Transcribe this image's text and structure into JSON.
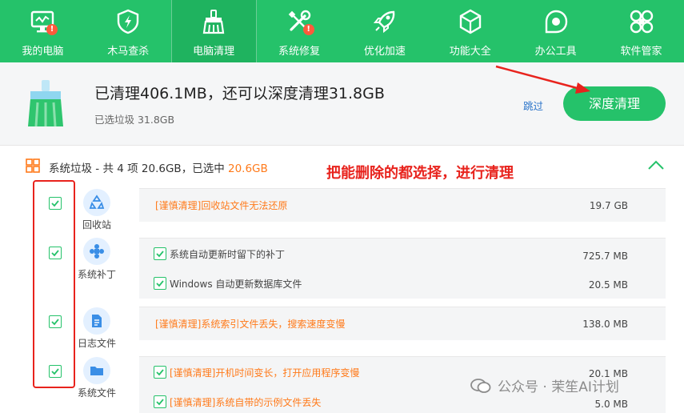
{
  "nav": {
    "items": [
      {
        "label": "我的电脑",
        "icon": "monitor-icon",
        "badge": "!"
      },
      {
        "label": "木马查杀",
        "icon": "shield-bolt-icon",
        "badge": ""
      },
      {
        "label": "电脑清理",
        "icon": "broom-icon",
        "badge": ""
      },
      {
        "label": "系统修复",
        "icon": "tools-icon",
        "badge": "!"
      },
      {
        "label": "优化加速",
        "icon": "rocket-icon",
        "badge": ""
      },
      {
        "label": "功能大全",
        "icon": "cube-icon",
        "badge": ""
      },
      {
        "label": "办公工具",
        "icon": "office-icon",
        "badge": ""
      },
      {
        "label": "软件管家",
        "icon": "apps-icon",
        "badge": ""
      }
    ],
    "active_index": 2
  },
  "summary": {
    "title": "已清理406.1MB，还可以深度清理31.8GB",
    "subtitle": "已选垃圾 31.8GB",
    "skip_label": "跳过",
    "deep_clean_label": "深度清理"
  },
  "section": {
    "title_prefix": "系统垃圾 - 共 4 项 20.6GB，已选中 ",
    "title_selected": "20.6GB",
    "annotation": "把能删除的都选择，进行清理"
  },
  "groups": [
    {
      "label": "回收站",
      "icon": "recycle-icon",
      "items": [
        {
          "text": "[谨慎清理]回收站文件无法还原",
          "size": "19.7 GB",
          "warn": true,
          "checkbox": false
        }
      ]
    },
    {
      "label": "系统补丁",
      "icon": "patch-icon",
      "items": [
        {
          "text": "系统自动更新时留下的补丁",
          "size": "725.7 MB",
          "warn": false,
          "checkbox": true
        },
        {
          "text": "Windows 自动更新数据库文件",
          "size": "20.5 MB",
          "warn": false,
          "checkbox": true
        }
      ]
    },
    {
      "label": "日志文件",
      "icon": "log-file-icon",
      "items": [
        {
          "text": "[谨慎清理]系统索引文件丢失，搜索速度变慢",
          "size": "138.0 MB",
          "warn": true,
          "checkbox": false
        }
      ]
    },
    {
      "label": "系统文件",
      "icon": "folder-icon",
      "items": [
        {
          "text": "[谨慎清理]开机时间变长，打开应用程序变慢",
          "size": "20.1 MB",
          "warn": true,
          "checkbox": true
        },
        {
          "text": "[谨慎清理]系统自带的示例文件丢失",
          "size": "5.0 MB",
          "warn": true,
          "checkbox": true
        }
      ]
    }
  ],
  "watermark": "公众号 · 茉笙AI计划",
  "colors": {
    "brand_green": "#25c26a",
    "warning_orange": "#ff7a1a",
    "annotation_red": "#e8231d",
    "link_blue": "#2a73c9"
  }
}
